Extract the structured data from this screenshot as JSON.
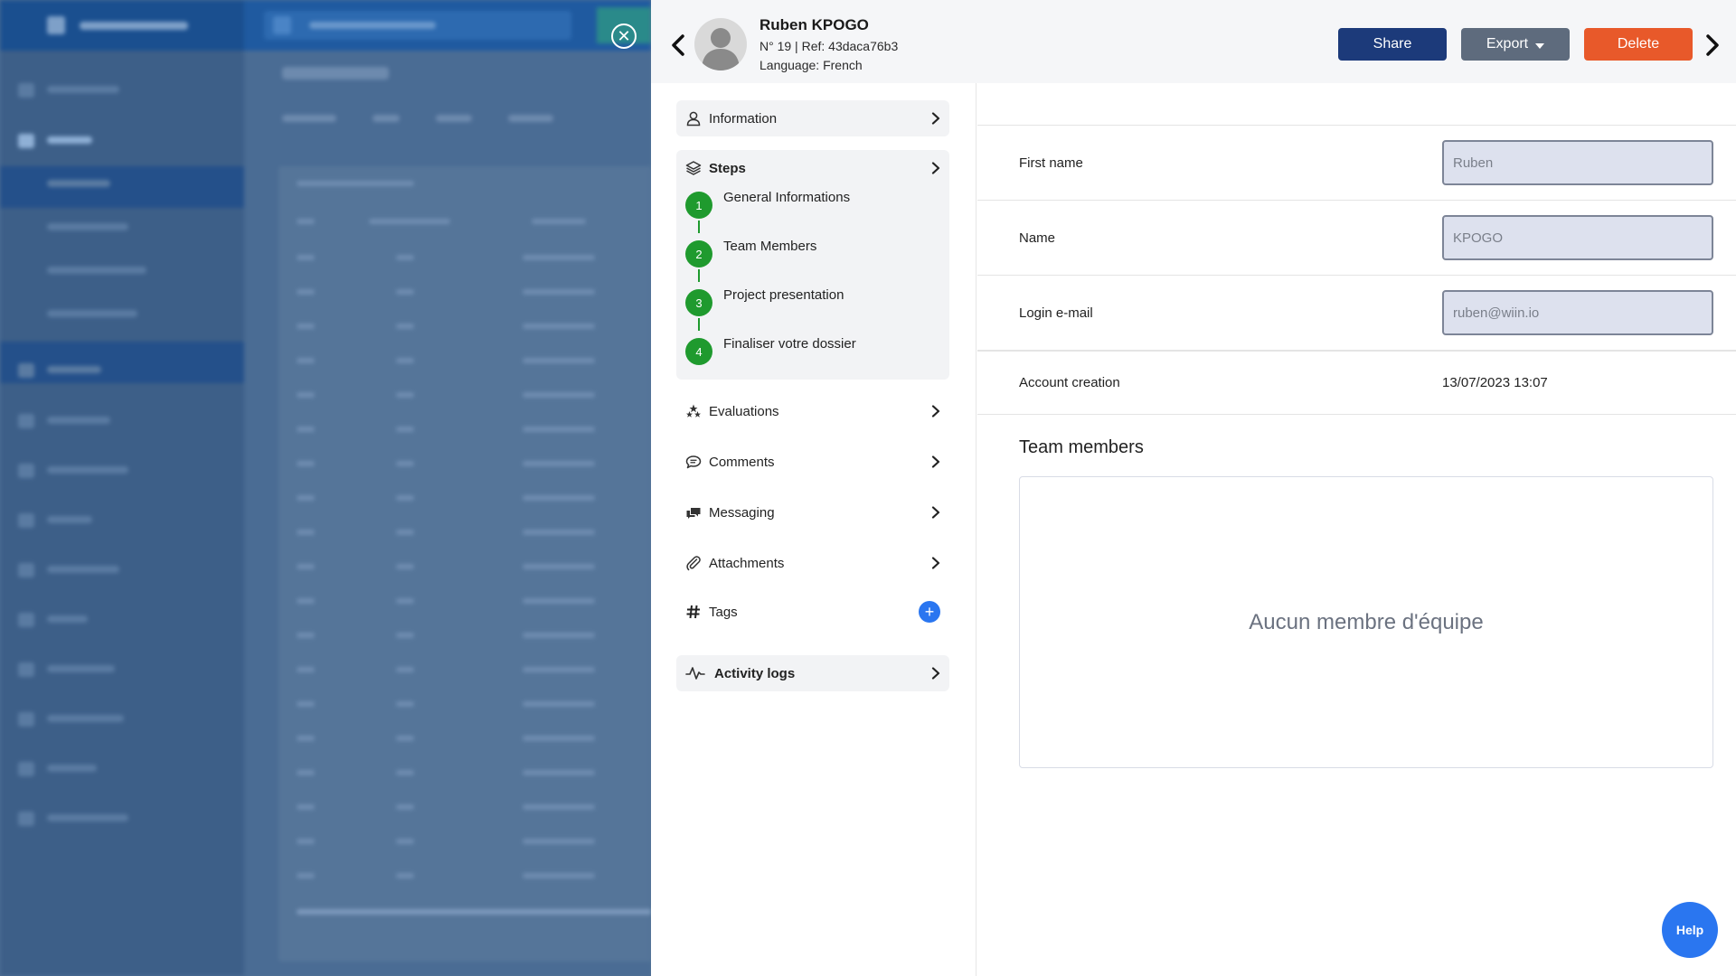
{
  "profile": {
    "name": "Ruben KPOGO",
    "ref_line": "N° 19 | Ref: 43daca76b3",
    "language_line": "Language: French"
  },
  "header_actions": {
    "share": "Share",
    "export": "Export",
    "delete": "Delete"
  },
  "menu": {
    "information": "Information",
    "steps_title": "Steps",
    "steps": [
      {
        "number": "1",
        "label": "General Informations"
      },
      {
        "number": "2",
        "label": "Team Members"
      },
      {
        "number": "3",
        "label": "Project presentation"
      },
      {
        "number": "4",
        "label": "Finaliser votre dossier"
      }
    ],
    "evaluations": "Evaluations",
    "comments": "Comments",
    "messaging": "Messaging",
    "attachments": "Attachments",
    "tags": "Tags",
    "activity_logs": "Activity logs"
  },
  "fields": {
    "first_name": {
      "label": "First name",
      "value": "Ruben"
    },
    "name": {
      "label": "Name",
      "value": "KPOGO"
    },
    "login_email": {
      "label": "Login e-mail",
      "value": "ruben@wiin.io"
    },
    "account_creation": {
      "label": "Account creation",
      "value": "13/07/2023 13:07"
    }
  },
  "team": {
    "title": "Team members",
    "empty_message": "Aucun membre d'équipe"
  },
  "help": "Help",
  "colors": {
    "share": "#1c3a7a",
    "export": "#5e6b7d",
    "delete": "#e8592a",
    "step": "#1f9a2e",
    "accent": "#2a76f0"
  },
  "icons": {
    "close": "close-circle-icon",
    "prev": "chevron-left-icon",
    "next": "chevron-right-icon",
    "information": "user-icon",
    "steps": "layers-icon",
    "evaluations": "stars-icon",
    "comments": "comment-icon",
    "messaging": "messaging-icon",
    "attachments": "paperclip-icon",
    "tags": "hashtag-icon",
    "activity_logs": "activity-icon"
  }
}
